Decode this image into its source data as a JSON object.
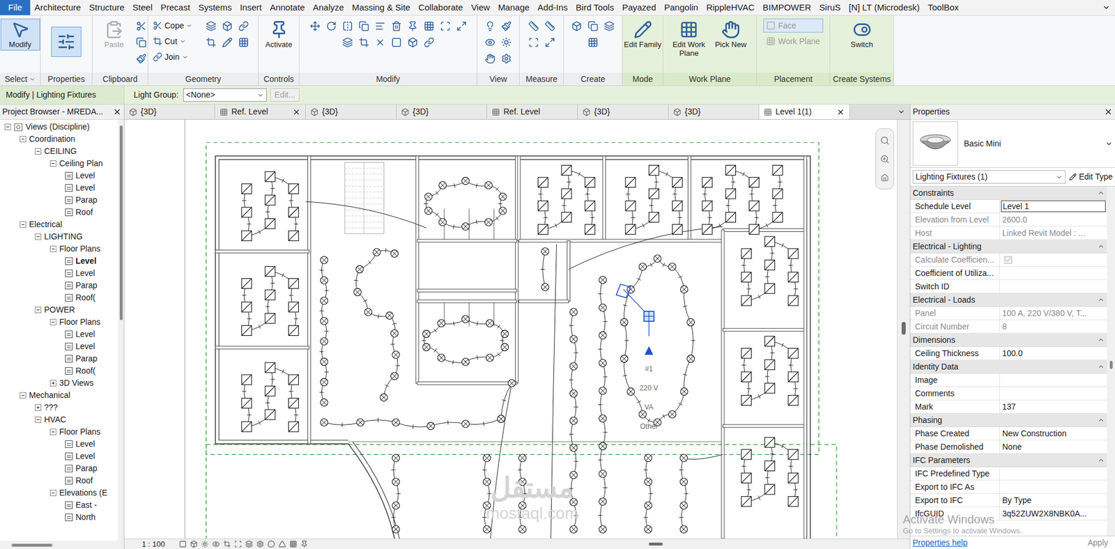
{
  "menu": {
    "tabs": [
      {
        "label": "File",
        "selected": true
      },
      {
        "label": "Architecture",
        "selected": false
      },
      {
        "label": "Structure",
        "selected": false
      },
      {
        "label": "Steel",
        "selected": false
      },
      {
        "label": "Precast",
        "selected": false
      },
      {
        "label": "Systems",
        "selected": false
      },
      {
        "label": "Insert",
        "selected": false
      },
      {
        "label": "Annotate",
        "selected": false
      },
      {
        "label": "Analyze",
        "selected": false
      },
      {
        "label": "Massing & Site",
        "selected": false
      },
      {
        "label": "Collaborate",
        "selected": false
      },
      {
        "label": "View",
        "selected": false
      },
      {
        "label": "Manage",
        "selected": false
      },
      {
        "label": "Add-Ins",
        "selected": false
      },
      {
        "label": "Bird Tools",
        "selected": false
      },
      {
        "label": "Payazed",
        "selected": false
      },
      {
        "label": "Pangolin",
        "selected": false
      },
      {
        "label": "RippleHVAC",
        "selected": false
      },
      {
        "label": "BIMPOWER",
        "selected": false
      },
      {
        "label": "SiruS",
        "selected": false
      },
      {
        "label": "[N] LT (Microdesk)",
        "selected": false
      },
      {
        "label": "ToolBox",
        "selected": false
      }
    ]
  },
  "ribbon": {
    "panels": [
      {
        "label": "Select",
        "contextual": false,
        "dropdown": true,
        "buttons": [
          {
            "label": "Modify",
            "kind": "large",
            "selected": true,
            "disabled": false,
            "dropdown": false
          }
        ]
      },
      {
        "label": "Properties",
        "contextual": false,
        "dropdown": false,
        "buttons": [
          {
            "kind": "icon",
            "selected": true,
            "disabled": false,
            "dropdown": false
          }
        ]
      },
      {
        "label": "Clipboard",
        "contextual": false,
        "dropdown": false,
        "buttons": [
          {
            "label": "Paste",
            "kind": "large",
            "selected": false,
            "disabled": true,
            "dropdown": false
          }
        ]
      },
      {
        "label": "Geometry",
        "contextual": false,
        "dropdown": false,
        "buttons": [
          {
            "label": "Cope",
            "kind": "small",
            "selected": false,
            "disabled": false,
            "dropdown": true
          },
          {
            "label": "Cut",
            "kind": "small",
            "selected": false,
            "disabled": false,
            "dropdown": true
          },
          {
            "label": "Join",
            "kind": "small",
            "selected": false,
            "disabled": false,
            "dropdown": true
          }
        ]
      },
      {
        "label": "Controls",
        "contextual": false,
        "dropdown": false,
        "buttons": [
          {
            "label": "Activate",
            "kind": "large",
            "selected": false,
            "disabled": false,
            "dropdown": false
          }
        ]
      },
      {
        "label": "Modify",
        "contextual": false,
        "dropdown": false,
        "buttons": []
      },
      {
        "label": "View",
        "contextual": false,
        "dropdown": false,
        "buttons": []
      },
      {
        "label": "Measure",
        "contextual": false,
        "dropdown": false,
        "buttons": []
      },
      {
        "label": "Create",
        "contextual": false,
        "dropdown": false,
        "buttons": []
      },
      {
        "label": "Mode",
        "contextual": true,
        "dropdown": false,
        "buttons": [
          {
            "label": "Edit Family",
            "kind": "large",
            "selected": false,
            "disabled": false,
            "dropdown": false
          }
        ]
      },
      {
        "label": "Work Plane",
        "contextual": true,
        "dropdown": false,
        "buttons": [
          {
            "label": "Edit Work Plane",
            "kind": "large",
            "selected": false,
            "disabled": false,
            "dropdown": false
          },
          {
            "label": "Pick New",
            "kind": "large",
            "selected": false,
            "disabled": false,
            "dropdown": false
          }
        ]
      },
      {
        "label": "Placement",
        "contextual": true,
        "dropdown": false,
        "buttons": [
          {
            "label": "Face",
            "kind": "small",
            "selected": true,
            "disabled": true,
            "dropdown": false
          },
          {
            "label": "Work Plane",
            "kind": "small",
            "selected": false,
            "disabled": true,
            "dropdown": false
          }
        ]
      },
      {
        "label": "Create Systems",
        "contextual": true,
        "dropdown": false,
        "buttons": [
          {
            "label": "Switch",
            "kind": "large",
            "selected": false,
            "disabled": false,
            "dropdown": false
          }
        ]
      }
    ]
  },
  "options_bar": {
    "context": "Modify | Lighting Fixtures",
    "field_label": "Light Group:",
    "field_value": "<None>",
    "button": {
      "label": "Edit...",
      "disabled": true
    }
  },
  "project_browser": {
    "title": "Project Browser - MREDA...",
    "items": [
      {
        "label": "Views (Discipline)",
        "depth": 0,
        "kind": "root",
        "expanded": true,
        "selected": false
      },
      {
        "label": "Coordination",
        "depth": 1,
        "kind": "group",
        "expanded": true,
        "selected": false
      },
      {
        "label": "CEILING",
        "depth": 2,
        "kind": "group",
        "expanded": true,
        "selected": false
      },
      {
        "label": "Ceiling Plan",
        "depth": 3,
        "kind": "group",
        "expanded": true,
        "selected": false
      },
      {
        "label": "Level",
        "depth": 4,
        "kind": "view",
        "expanded": false,
        "selected": false
      },
      {
        "label": "Level",
        "depth": 4,
        "kind": "view",
        "expanded": false,
        "selected": false
      },
      {
        "label": "Parap",
        "depth": 4,
        "kind": "view",
        "expanded": false,
        "selected": false
      },
      {
        "label": "Roof",
        "depth": 4,
        "kind": "view",
        "expanded": false,
        "selected": false
      },
      {
        "label": "Electrical",
        "depth": 1,
        "kind": "group",
        "expanded": true,
        "selected": false
      },
      {
        "label": "LIGHTING",
        "depth": 2,
        "kind": "group",
        "expanded": true,
        "selected": false
      },
      {
        "label": "Floor Plans",
        "depth": 3,
        "kind": "group",
        "expanded": true,
        "selected": false
      },
      {
        "label": "Level",
        "depth": 4,
        "kind": "view",
        "expanded": false,
        "selected": true
      },
      {
        "label": "Level",
        "depth": 4,
        "kind": "view",
        "expanded": false,
        "selected": false
      },
      {
        "label": "Parap",
        "depth": 4,
        "kind": "view",
        "expanded": false,
        "selected": false
      },
      {
        "label": "Roof(",
        "depth": 4,
        "kind": "view",
        "expanded": false,
        "selected": false
      },
      {
        "label": "POWER",
        "depth": 2,
        "kind": "group",
        "expanded": true,
        "selected": false
      },
      {
        "label": "Floor Plans",
        "depth": 3,
        "kind": "group",
        "expanded": true,
        "selected": false
      },
      {
        "label": "Level",
        "depth": 4,
        "kind": "view",
        "expanded": false,
        "selected": false
      },
      {
        "label": "Level",
        "depth": 4,
        "kind": "view",
        "expanded": false,
        "selected": false
      },
      {
        "label": "Parap",
        "depth": 4,
        "kind": "view",
        "expanded": false,
        "selected": false
      },
      {
        "label": "Roof(",
        "depth": 4,
        "kind": "view",
        "expanded": false,
        "selected": false
      },
      {
        "label": "3D Views",
        "depth": 3,
        "kind": "group",
        "expanded": false,
        "selected": false
      },
      {
        "label": "Mechanical",
        "depth": 1,
        "kind": "group",
        "expanded": true,
        "selected": false
      },
      {
        "label": "???",
        "depth": 2,
        "kind": "group",
        "expanded": false,
        "selected": false
      },
      {
        "label": "HVAC",
        "depth": 2,
        "kind": "group",
        "expanded": true,
        "selected": false
      },
      {
        "label": "Floor Plans",
        "depth": 3,
        "kind": "group",
        "expanded": true,
        "selected": false
      },
      {
        "label": "Level",
        "depth": 4,
        "kind": "view",
        "expanded": false,
        "selected": false
      },
      {
        "label": "Level",
        "depth": 4,
        "kind": "view",
        "expanded": false,
        "selected": false
      },
      {
        "label": "Parap",
        "depth": 4,
        "kind": "view",
        "expanded": false,
        "selected": false
      },
      {
        "label": "Roof",
        "depth": 4,
        "kind": "view",
        "expanded": false,
        "selected": false
      },
      {
        "label": "Elevations (E",
        "depth": 3,
        "kind": "group",
        "expanded": true,
        "selected": false
      },
      {
        "label": "East -",
        "depth": 4,
        "kind": "view",
        "expanded": false,
        "selected": false
      },
      {
        "label": "North",
        "depth": 4,
        "kind": "view",
        "expanded": false,
        "selected": false
      }
    ]
  },
  "view_tabs": [
    {
      "label": "{3D}",
      "kind": "3d",
      "closable": false,
      "selected": false
    },
    {
      "label": "Ref. Level",
      "kind": "plan",
      "closable": true,
      "selected": false
    },
    {
      "label": "{3D}",
      "kind": "3d",
      "closable": false,
      "selected": false
    },
    {
      "label": "{3D}",
      "kind": "3d",
      "closable": false,
      "selected": false
    },
    {
      "label": "Ref. Level",
      "kind": "plan",
      "closable": false,
      "selected": false
    },
    {
      "label": "{3D}",
      "kind": "3d",
      "closable": false,
      "selected": false
    },
    {
      "label": "{3D}",
      "kind": "3d",
      "closable": false,
      "selected": false
    },
    {
      "label": "Level 1(1)",
      "kind": "plan",
      "closable": true,
      "selected": true
    }
  ],
  "drawing": {
    "tags": [
      "#1",
      "220 V",
      "VA",
      "Other"
    ]
  },
  "status_bar": {
    "scale": "1 : 100"
  },
  "properties": {
    "title": "Properties",
    "type_name": "Basic Mini",
    "category": "Lighting Fixtures (1)",
    "edit_type": "Edit Type",
    "sections": [
      {
        "title": "Constraints",
        "rows": [
          {
            "label": "Schedule Level",
            "value": "Level 1",
            "kind": "field",
            "disabled": false,
            "checked": false
          },
          {
            "label": "Elevation from Level",
            "value": "2600.0",
            "kind": "text",
            "disabled": true,
            "checked": false
          },
          {
            "label": "Host",
            "value": "Linked Revit Model : ...",
            "kind": "text",
            "disabled": true,
            "checked": false
          }
        ]
      },
      {
        "title": "Electrical - Lighting",
        "rows": [
          {
            "label": "Calculate Coefficien...",
            "value": "",
            "kind": "checkbox",
            "disabled": true,
            "checked": true
          },
          {
            "label": "Coefficient of Utiliza...",
            "value": "",
            "kind": "text",
            "disabled": false,
            "checked": false
          },
          {
            "label": "Switch ID",
            "value": "",
            "kind": "text",
            "disabled": false,
            "checked": false
          }
        ]
      },
      {
        "title": "Electrical - Loads",
        "rows": [
          {
            "label": "Panel",
            "value": "100 A, 220 V/380 V, T...",
            "kind": "text",
            "disabled": true,
            "checked": false
          },
          {
            "label": "Circuit Number",
            "value": "8",
            "kind": "text",
            "disabled": true,
            "checked": false
          }
        ]
      },
      {
        "title": "Dimensions",
        "rows": [
          {
            "label": "Ceiling Thickness",
            "value": "100.0",
            "kind": "text",
            "disabled": false,
            "checked": false
          }
        ]
      },
      {
        "title": "Identity Data",
        "rows": [
          {
            "label": "Image",
            "value": "",
            "kind": "text",
            "disabled": false,
            "checked": false
          },
          {
            "label": "Comments",
            "value": "",
            "kind": "text",
            "disabled": false,
            "checked": false
          },
          {
            "label": "Mark",
            "value": "137",
            "kind": "text",
            "disabled": false,
            "checked": false
          }
        ]
      },
      {
        "title": "Phasing",
        "rows": [
          {
            "label": "Phase Created",
            "value": "New Construction",
            "kind": "text",
            "disabled": false,
            "checked": false
          },
          {
            "label": "Phase Demolished",
            "value": "None",
            "kind": "text",
            "disabled": false,
            "checked": false
          }
        ]
      },
      {
        "title": "IFC Parameters",
        "rows": [
          {
            "label": "IFC Predefined Type",
            "value": "",
            "kind": "text",
            "disabled": false,
            "checked": false
          },
          {
            "label": "Export to IFC As",
            "value": "",
            "kind": "text",
            "disabled": false,
            "checked": false
          },
          {
            "label": "Export to IFC",
            "value": "By Type",
            "kind": "text",
            "disabled": false,
            "checked": false
          },
          {
            "label": "IfcGUID",
            "value": "3q52ZUW2X8NBK0A...",
            "kind": "text",
            "disabled": false,
            "checked": false
          }
        ]
      }
    ],
    "help_link": "Properties help",
    "apply": "Apply"
  },
  "watermarks": {
    "site": [
      "مستقل",
      "mostaql.com"
    ],
    "activation": [
      "Activate Windows",
      "Go to Settings to activate Windows."
    ]
  }
}
